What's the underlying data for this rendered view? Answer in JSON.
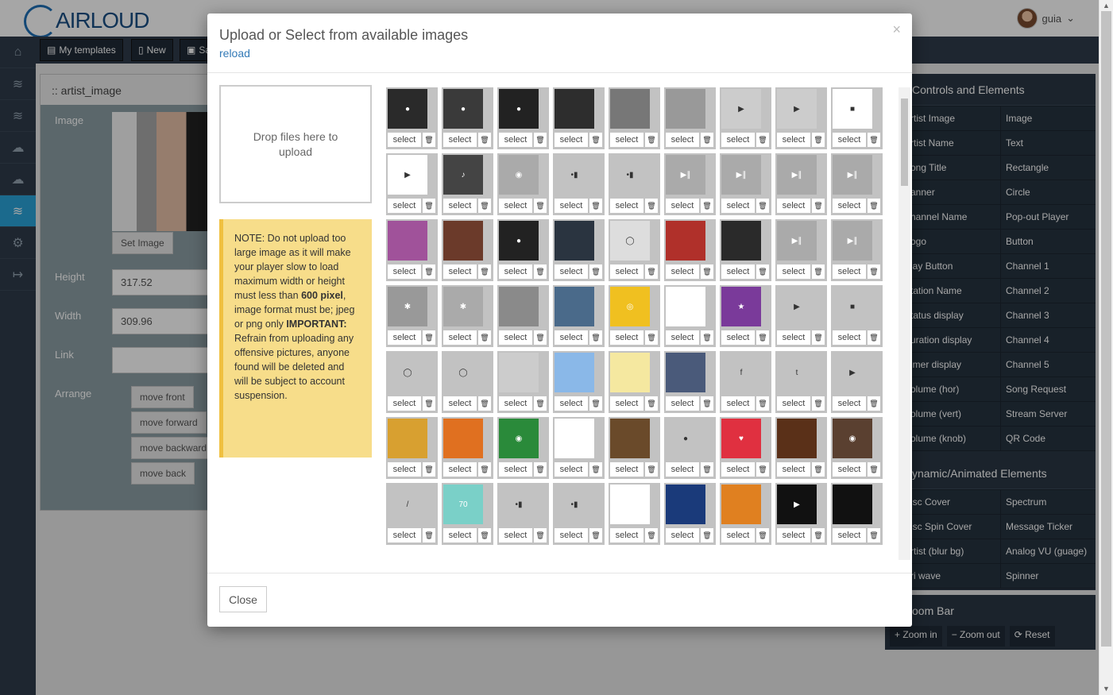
{
  "brand": {
    "logo_text": "AIRLOUD"
  },
  "user": {
    "name": "guia",
    "caret": "⌄"
  },
  "toolbar": {
    "my_templates": "My templates",
    "new": "New",
    "save": "Sa"
  },
  "left_panel": {
    "title": ":: artist_image",
    "image_label": "Image",
    "set_image": "Set Image",
    "height_label": "Height",
    "height_value": "317.52",
    "width_label": "Width",
    "width_value": "309.96",
    "link_label": "Link",
    "arrange_label": "Arrange",
    "move_front": "move front",
    "move_forward": "move forward",
    "move_backward": "move backward",
    "move_back": "move back"
  },
  "right_panel": {
    "controls_title": "Controls and Elements",
    "controls": [
      [
        "rtist Image",
        "Image"
      ],
      [
        "rtist Name",
        "Text"
      ],
      [
        "ong Title",
        "Rectangle"
      ],
      [
        "anner",
        "Circle"
      ],
      [
        "hannel Name",
        "Pop-out Player"
      ],
      [
        "ogo",
        "Button"
      ],
      [
        "lay Button",
        "Channel 1"
      ],
      [
        "tation Name",
        "Channel 2"
      ],
      [
        "tatus display",
        "Channel 3"
      ],
      [
        "uration display",
        "Channel 4"
      ],
      [
        "imer display",
        "Channel 5"
      ],
      [
        "olume (hor)",
        "Song Request"
      ],
      [
        "olume (vert)",
        "Stream Server"
      ],
      [
        "olume (knob)",
        "QR Code"
      ]
    ],
    "dynamic_title": "ynamic/Animated Elements",
    "dynamic": [
      [
        "isc Cover",
        "Spectrum"
      ],
      [
        "isc Spin Cover",
        "Message Ticker"
      ],
      [
        "rtist (blur bg)",
        "Analog VU (guage)"
      ],
      [
        "ri wave",
        "Spinner"
      ]
    ],
    "zoom_title": "oom Bar",
    "zoom_in": "Zoom in",
    "zoom_out": "Zoom out",
    "reset": "Reset"
  },
  "modal": {
    "title": "Upload or Select from available images",
    "reload": "reload",
    "close_x": "×",
    "dropzone": "Drop files here to upload",
    "note_1": "NOTE: Do not upload too large image as it will make your player slow to load maximum width or height must less than ",
    "note_bold_1": "600 pixel",
    "note_2": ", image format must be; jpeg or png only ",
    "note_bold_2": "IMPORTANT:",
    "note_3": " Refrain from uploading any offensive pictures, anyone found will be deleted and will be subject to account suspension.",
    "close_button": "Close",
    "select_label": "select",
    "tiles": [
      {
        "bg": "#2a2a2a",
        "glyph": "●"
      },
      {
        "bg": "#3a3a3a",
        "glyph": "●"
      },
      {
        "bg": "#222",
        "glyph": "●"
      },
      {
        "bg": "#2d2d2d",
        "glyph": ""
      },
      {
        "bg": "#777",
        "glyph": ""
      },
      {
        "bg": "#999",
        "glyph": ""
      },
      {
        "bg": "#ccc",
        "glyph": "▶"
      },
      {
        "bg": "#ccc",
        "glyph": "▶"
      },
      {
        "bg": "#fff",
        "glyph": "■"
      },
      {
        "bg": "#fff",
        "glyph": "▶"
      },
      {
        "bg": "#444",
        "glyph": "♪"
      },
      {
        "bg": "#aaa",
        "glyph": "◉"
      },
      {
        "bg": "#c2c2c2",
        "glyph": "•▮"
      },
      {
        "bg": "#c2c2c2",
        "glyph": "•▮"
      },
      {
        "bg": "#aaa",
        "glyph": "▶∥"
      },
      {
        "bg": "#aaa",
        "glyph": "▶∥"
      },
      {
        "bg": "#aaa",
        "glyph": "▶∥"
      },
      {
        "bg": "#aaa",
        "glyph": "▶∥"
      },
      {
        "bg": "#a0529a",
        "glyph": ""
      },
      {
        "bg": "#6b3a2a",
        "glyph": ""
      },
      {
        "bg": "#222",
        "glyph": "●"
      },
      {
        "bg": "#2a3440",
        "glyph": ""
      },
      {
        "bg": "#ddd",
        "glyph": "◯"
      },
      {
        "bg": "#b0302a",
        "glyph": ""
      },
      {
        "bg": "#2a2a2a",
        "glyph": ""
      },
      {
        "bg": "#aaa",
        "glyph": "▶∥"
      },
      {
        "bg": "#aaa",
        "glyph": "▶∥"
      },
      {
        "bg": "#999",
        "glyph": "✱"
      },
      {
        "bg": "#aaa",
        "glyph": "✱"
      },
      {
        "bg": "#8a8a8a",
        "glyph": ""
      },
      {
        "bg": "#4a6a8a",
        "glyph": ""
      },
      {
        "bg": "#f0c020",
        "glyph": "◎"
      },
      {
        "bg": "#fff",
        "glyph": ""
      },
      {
        "bg": "#7a3a9a",
        "glyph": "★"
      },
      {
        "bg": "#c2c2c2",
        "glyph": "▶"
      },
      {
        "bg": "#c2c2c2",
        "glyph": "■"
      },
      {
        "bg": "#c2c2c2",
        "glyph": "◯"
      },
      {
        "bg": "#c2c2c2",
        "glyph": "◯"
      },
      {
        "bg": "#ccc",
        "glyph": ""
      },
      {
        "bg": "#8ab8e8",
        "glyph": ""
      },
      {
        "bg": "#f5e8a0",
        "glyph": ""
      },
      {
        "bg": "#4a5a7a",
        "glyph": ""
      },
      {
        "bg": "#c2c2c2",
        "glyph": "f"
      },
      {
        "bg": "#c2c2c2",
        "glyph": "t"
      },
      {
        "bg": "#c2c2c2",
        "glyph": "▶"
      },
      {
        "bg": "#d8a030",
        "glyph": ""
      },
      {
        "bg": "#e07020",
        "glyph": ""
      },
      {
        "bg": "#2a8a3a",
        "glyph": "◉"
      },
      {
        "bg": "#fff",
        "glyph": ""
      },
      {
        "bg": "#6a4a2a",
        "glyph": ""
      },
      {
        "bg": "#c2c2c2",
        "glyph": "●"
      },
      {
        "bg": "#e03040",
        "glyph": "♥"
      },
      {
        "bg": "#5a3018",
        "glyph": ""
      },
      {
        "bg": "#5a4030",
        "glyph": "◉"
      },
      {
        "bg": "#c2c2c2",
        "glyph": "/"
      },
      {
        "bg": "#7ad0c8",
        "glyph": "70"
      },
      {
        "bg": "#c2c2c2",
        "glyph": "•▮"
      },
      {
        "bg": "#c2c2c2",
        "glyph": "•▮"
      },
      {
        "bg": "#fff",
        "glyph": ""
      },
      {
        "bg": "#1a3a7a",
        "glyph": ""
      },
      {
        "bg": "#e08020",
        "glyph": ""
      },
      {
        "bg": "#111",
        "glyph": "▶"
      },
      {
        "bg": "#111",
        "glyph": ""
      }
    ]
  }
}
